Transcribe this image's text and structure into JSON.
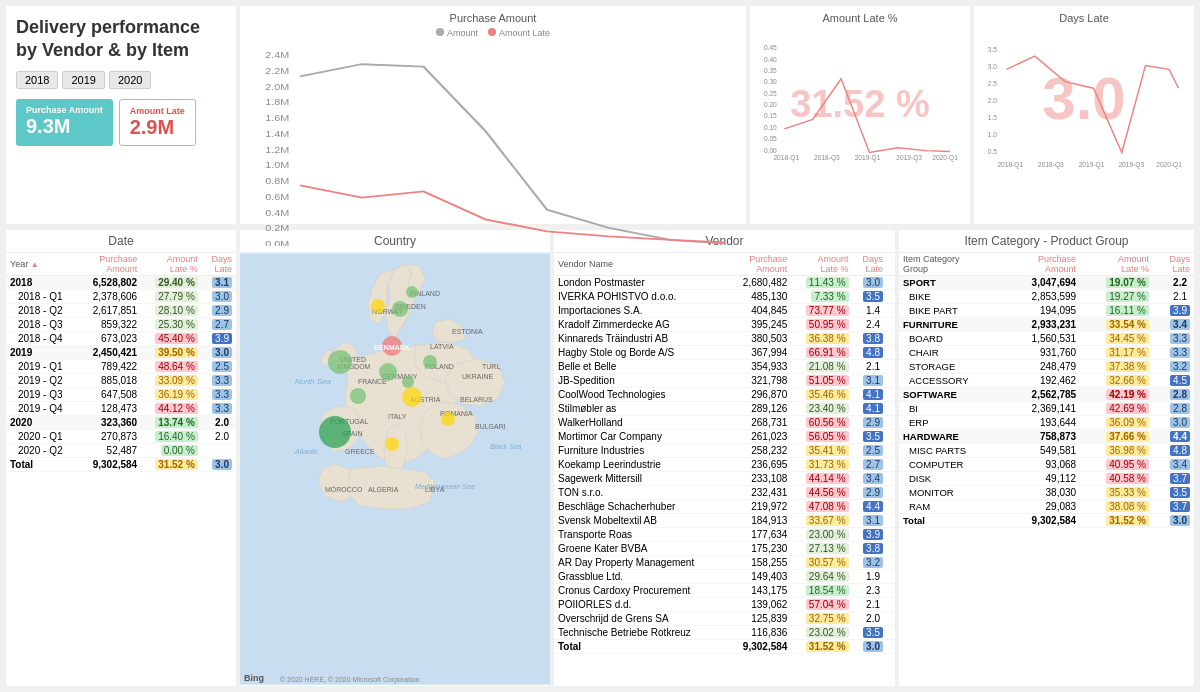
{
  "title": {
    "line1": "Delivery performance",
    "line2": "by Vendor & by Item"
  },
  "years": [
    "2018",
    "2019",
    "2020"
  ],
  "metrics": {
    "purchase_label": "Purchase Amount",
    "purchase_value": "9.3M",
    "late_label": "Amount Late",
    "late_value": "2.9M"
  },
  "charts": {
    "purchase_amount": {
      "title": "Purchase Amount",
      "legend_amount": "Amount",
      "legend_amount_late": "Amount Late"
    },
    "amount_late_pct": {
      "title": "Amount Late %",
      "kpi": "31.52 %"
    },
    "days_late": {
      "title": "Days Late",
      "kpi": "3.0"
    }
  },
  "date_table": {
    "section_title": "Date",
    "headers": [
      "Year",
      "Purchase Amount",
      "Amount Late %",
      "Days Late"
    ],
    "rows": [
      {
        "year": "2018",
        "amount": "6,528,802",
        "pct": "29.40 %",
        "days": "3.1",
        "is_year": true
      },
      {
        "year": "2018 - Q1",
        "amount": "2,378,606",
        "pct": "27.79 %",
        "days": "3.0",
        "is_year": false
      },
      {
        "year": "2018 - Q2",
        "amount": "2,617,851",
        "pct": "28.10 %",
        "days": "2.9",
        "is_year": false
      },
      {
        "year": "2018 - Q3",
        "amount": "859,322",
        "pct": "25.30 %",
        "days": "2.7",
        "is_year": false
      },
      {
        "year": "2018 - Q4",
        "amount": "673,023",
        "pct": "45.40 %",
        "days": "3.9",
        "is_year": false
      },
      {
        "year": "2019",
        "amount": "2,450,421",
        "pct": "39.50 %",
        "days": "3.0",
        "is_year": true
      },
      {
        "year": "2019 - Q1",
        "amount": "789,422",
        "pct": "48.64 %",
        "days": "2.5",
        "is_year": false
      },
      {
        "year": "2019 - Q2",
        "amount": "885,018",
        "pct": "33.09 %",
        "days": "3.3",
        "is_year": false
      },
      {
        "year": "2019 - Q3",
        "amount": "647,508",
        "pct": "36.19 %",
        "days": "3.3",
        "is_year": false
      },
      {
        "year": "2019 - Q4",
        "amount": "128,473",
        "pct": "44.12 %",
        "days": "3.3",
        "is_year": false
      },
      {
        "year": "2020",
        "amount": "323,360",
        "pct": "13.74 %",
        "days": "2.0",
        "is_year": true
      },
      {
        "year": "2020 - Q1",
        "amount": "270,873",
        "pct": "16.40 %",
        "days": "2.0",
        "is_year": false
      },
      {
        "year": "2020 - Q2",
        "amount": "52,487",
        "pct": "0.00 %",
        "days": "",
        "is_year": false
      },
      {
        "year": "Total",
        "amount": "9,302,584",
        "pct": "31.52 %",
        "days": "3.0",
        "is_total": true
      }
    ]
  },
  "vendor_table": {
    "section_title": "Vendor",
    "headers": [
      "Vendor Name",
      "Purchase Amount",
      "Amount Late %",
      "Days Late"
    ],
    "rows": [
      {
        "name": "London Postmaster",
        "amount": "2,680,482",
        "pct": "11.43 %",
        "days": "3.0"
      },
      {
        "name": "IVERKA POHISTVO d.o.o.",
        "amount": "485,130",
        "pct": "7.33 %",
        "days": "3.5"
      },
      {
        "name": "Importaciones S.A.",
        "amount": "404,845",
        "pct": "73.77 %",
        "days": "1.4"
      },
      {
        "name": "Kradolf Zimmerdecke AG",
        "amount": "395,245",
        "pct": "50.95 %",
        "days": "2.4"
      },
      {
        "name": "Kinnareds Träindustri AB",
        "amount": "380,503",
        "pct": "36.38 %",
        "days": "3.8"
      },
      {
        "name": "Hagby Stole og Borde A/S",
        "amount": "367,994",
        "pct": "66.91 %",
        "days": "4.8"
      },
      {
        "name": "Belle et Belle",
        "amount": "354,933",
        "pct": "21.08 %",
        "days": "2.1"
      },
      {
        "name": "JB-Spedition",
        "amount": "321,798",
        "pct": "51.05 %",
        "days": "3.1"
      },
      {
        "name": "CoolWood Technologies",
        "amount": "296,870",
        "pct": "35.46 %",
        "days": "4.1"
      },
      {
        "name": "Stilmøbler as",
        "amount": "289,126",
        "pct": "23.40 %",
        "days": "4.1"
      },
      {
        "name": "WalkerHolland",
        "amount": "268,731",
        "pct": "60.56 %",
        "days": "2.9"
      },
      {
        "name": "Mortimor Car Company",
        "amount": "261,023",
        "pct": "56.05 %",
        "days": "3.5"
      },
      {
        "name": "Furniture Industries",
        "amount": "258,232",
        "pct": "35.41 %",
        "days": "2.5"
      },
      {
        "name": "Koekamp Leerindustrie",
        "amount": "236,695",
        "pct": "31.73 %",
        "days": "2.7"
      },
      {
        "name": "Sagewerk Mittersill",
        "amount": "233,108",
        "pct": "44.14 %",
        "days": "3.4"
      },
      {
        "name": "TON s.r.o.",
        "amount": "232,431",
        "pct": "44.56 %",
        "days": "2.9"
      },
      {
        "name": "Beschläge Schacherhuber",
        "amount": "219,972",
        "pct": "47.08 %",
        "days": "4.4"
      },
      {
        "name": "Svensk Mobeltextil AB",
        "amount": "184,913",
        "pct": "33.67 %",
        "days": "3.1"
      },
      {
        "name": "Transporte Roas",
        "amount": "177,634",
        "pct": "23.00 %",
        "days": "3.9"
      },
      {
        "name": "Groene Kater BVBA",
        "amount": "175,230",
        "pct": "27.13 %",
        "days": "3.8"
      },
      {
        "name": "AR Day Property Management",
        "amount": "158,255",
        "pct": "30.57 %",
        "days": "3.2"
      },
      {
        "name": "Grassblue Ltd.",
        "amount": "149,403",
        "pct": "29.64 %",
        "days": "1.9"
      },
      {
        "name": "Cronus Cardoxy Procurement",
        "amount": "143,175",
        "pct": "18.54 %",
        "days": "2.3"
      },
      {
        "name": "POIIORLES d.d.",
        "amount": "139,062",
        "pct": "57.04 %",
        "days": "2.1"
      },
      {
        "name": "Overschrijd de Grens SA",
        "amount": "125,839",
        "pct": "32.75 %",
        "days": "2.0"
      },
      {
        "name": "Technische Betriebe Rotkreuz",
        "amount": "116,836",
        "pct": "23.02 %",
        "days": "3.5"
      },
      {
        "name": "Total",
        "amount": "9,302,584",
        "pct": "31.52 %",
        "days": "3.0",
        "is_total": true
      }
    ]
  },
  "item_table": {
    "section_title": "Item Category - Product Group",
    "headers": [
      "Item Category Group",
      "Purchase Amount",
      "Amount Late %",
      "Days Late"
    ],
    "rows": [
      {
        "name": "SPORT",
        "amount": "3,047,694",
        "pct": "19.07 %",
        "days": "2.2",
        "is_category": true
      },
      {
        "name": "BIKE",
        "amount": "2,853,599",
        "pct": "19.27 %",
        "days": "2.1",
        "is_category": false
      },
      {
        "name": "BIKE PART",
        "amount": "194,095",
        "pct": "16.11 %",
        "days": "3.9",
        "is_category": false
      },
      {
        "name": "FURNITURE",
        "amount": "2,933,231",
        "pct": "33.54 %",
        "days": "3.4",
        "is_category": true
      },
      {
        "name": "BOARD",
        "amount": "1,560,531",
        "pct": "34.45 %",
        "days": "3.3",
        "is_category": false
      },
      {
        "name": "CHAIR",
        "amount": "931,760",
        "pct": "31.17 %",
        "days": "3.3",
        "is_category": false
      },
      {
        "name": "STORAGE",
        "amount": "248,479",
        "pct": "37.38 %",
        "days": "3.2",
        "is_category": false
      },
      {
        "name": "ACCESSORY",
        "amount": "192,462",
        "pct": "32.66 %",
        "days": "4.5",
        "is_category": false
      },
      {
        "name": "SOFTWARE",
        "amount": "2,562,785",
        "pct": "42.19 %",
        "days": "2.8",
        "is_category": true
      },
      {
        "name": "BI",
        "amount": "2,369,141",
        "pct": "42.69 %",
        "days": "2.8",
        "is_category": false
      },
      {
        "name": "ERP",
        "amount": "193,644",
        "pct": "36.09 %",
        "days": "3.0",
        "is_category": false
      },
      {
        "name": "HARDWARE",
        "amount": "758,873",
        "pct": "37.66 %",
        "days": "4.4",
        "is_category": true
      },
      {
        "name": "MISC PARTS",
        "amount": "549,581",
        "pct": "36.98 %",
        "days": "4.8",
        "is_category": false
      },
      {
        "name": "COMPUTER",
        "amount": "93,068",
        "pct": "40.95 %",
        "days": "3.4",
        "is_category": false
      },
      {
        "name": "DISK",
        "amount": "49,112",
        "pct": "40.58 %",
        "days": "3.7",
        "is_category": false
      },
      {
        "name": "MONITOR",
        "amount": "38,030",
        "pct": "35.33 %",
        "days": "3.5",
        "is_category": false
      },
      {
        "name": "RAM",
        "amount": "29,083",
        "pct": "38.08 %",
        "days": "3.7",
        "is_category": false
      },
      {
        "name": "Total",
        "amount": "9,302,584",
        "pct": "31.52 %",
        "days": "3.0",
        "is_total": true
      }
    ]
  },
  "map": {
    "title": "Country",
    "copyright": "© 2020 HERE, © 2020 Microsoft Corporation"
  },
  "colors": {
    "accent_teal": "#5ec8c8",
    "accent_red": "#e05050",
    "chart_gray": "#aaaaaa",
    "chart_pink": "#f08080",
    "highlight_blue": "#4472c4",
    "highlight_light_blue": "#9dc3e6"
  }
}
